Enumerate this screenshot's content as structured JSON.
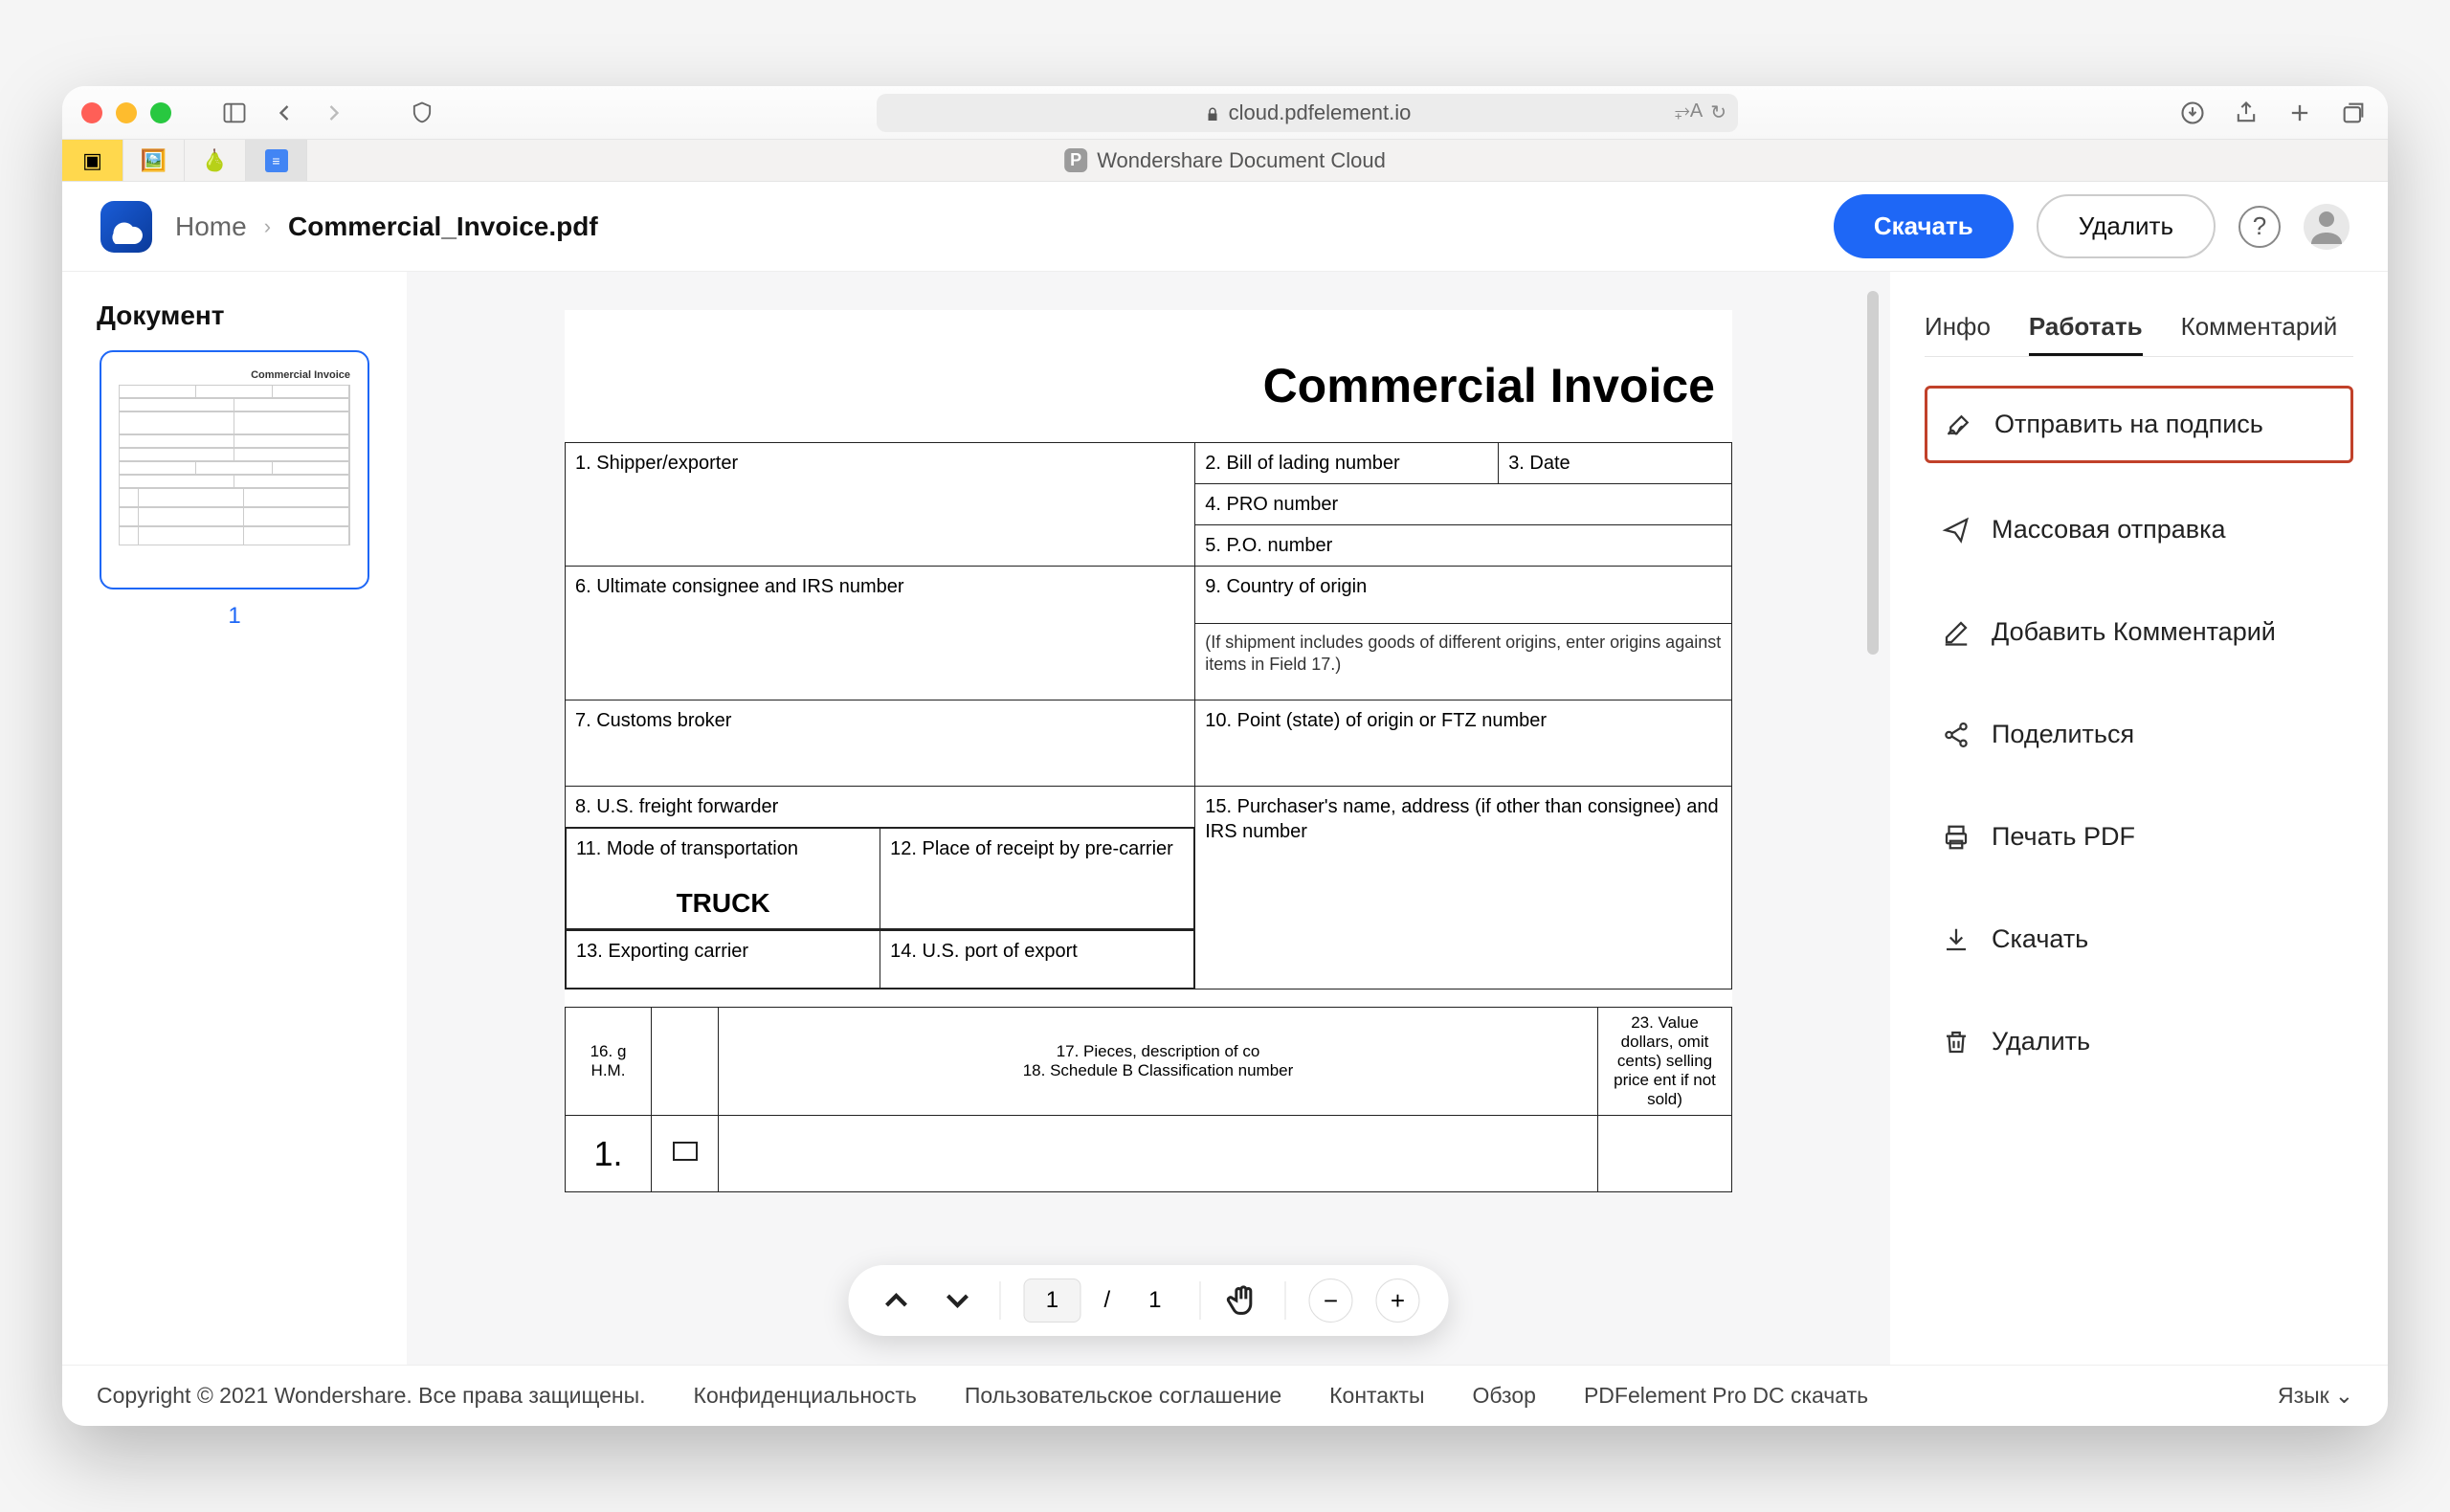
{
  "browser": {
    "url": "cloud.pdfelement.io",
    "tab_title": "Wondershare Document Cloud"
  },
  "header": {
    "breadcrumb_home": "Home",
    "breadcrumb_file": "Commercial_Invoice.pdf",
    "download_btn": "Скачать",
    "delete_btn": "Удалить"
  },
  "left_panel": {
    "title": "Документ",
    "thumb_number": "1"
  },
  "document": {
    "title": "Commercial Invoice",
    "fields": {
      "f1": "1. Shipper/exporter",
      "f2": "2. Bill of lading number",
      "f3": "3. Date",
      "f4": "4. PRO number",
      "f5": "5. P.O. number",
      "f6": "6. Ultimate consignee and IRS number",
      "f9": "9. Country of origin",
      "f9_note": "(If shipment includes goods of different origins, enter origins against items in Field 17.)",
      "f7": "7. Customs broker",
      "f10": "10. Point (state) of origin or FTZ number",
      "f8": "8. U.S. freight forwarder",
      "f15": "15. Purchaser's name, address (if other than consignee) and IRS number",
      "f11": "11. Mode of transportation",
      "f11_value": "TRUCK",
      "f12": "12. Place of receipt by pre-carrier",
      "f13": "13. Exporting carrier",
      "f14": "14. U.S. port of export",
      "lower_c1": "16. g H.M.",
      "lower_c2": "17. Pieces, description of co",
      "lower_c2b": "18. Schedule B Classification number",
      "lower_c3": "23. Value dollars, omit cents) selling price ent if not sold)",
      "row_num": "1."
    }
  },
  "viewer_toolbar": {
    "current_page": "1",
    "separator": "/",
    "total_pages": "1"
  },
  "right_panel": {
    "tabs": {
      "info": "Инфо",
      "work": "Работать",
      "comment": "Комментарий"
    },
    "actions": {
      "send_signature": "Отправить на подпись",
      "bulk_send": "Массовая отправка",
      "add_comment": "Добавить Комментарий",
      "share": "Поделиться",
      "print": "Печать PDF",
      "download": "Скачать",
      "delete": "Удалить"
    }
  },
  "footer": {
    "copyright": "Copyright © 2021 Wondershare. Все права защищены.",
    "privacy": "Конфиденциальность",
    "agreement": "Пользовательское соглашение",
    "contacts": "Контакты",
    "review": "Обзор",
    "download_pro": "PDFelement Pro DC скачать",
    "language": "Язык"
  }
}
